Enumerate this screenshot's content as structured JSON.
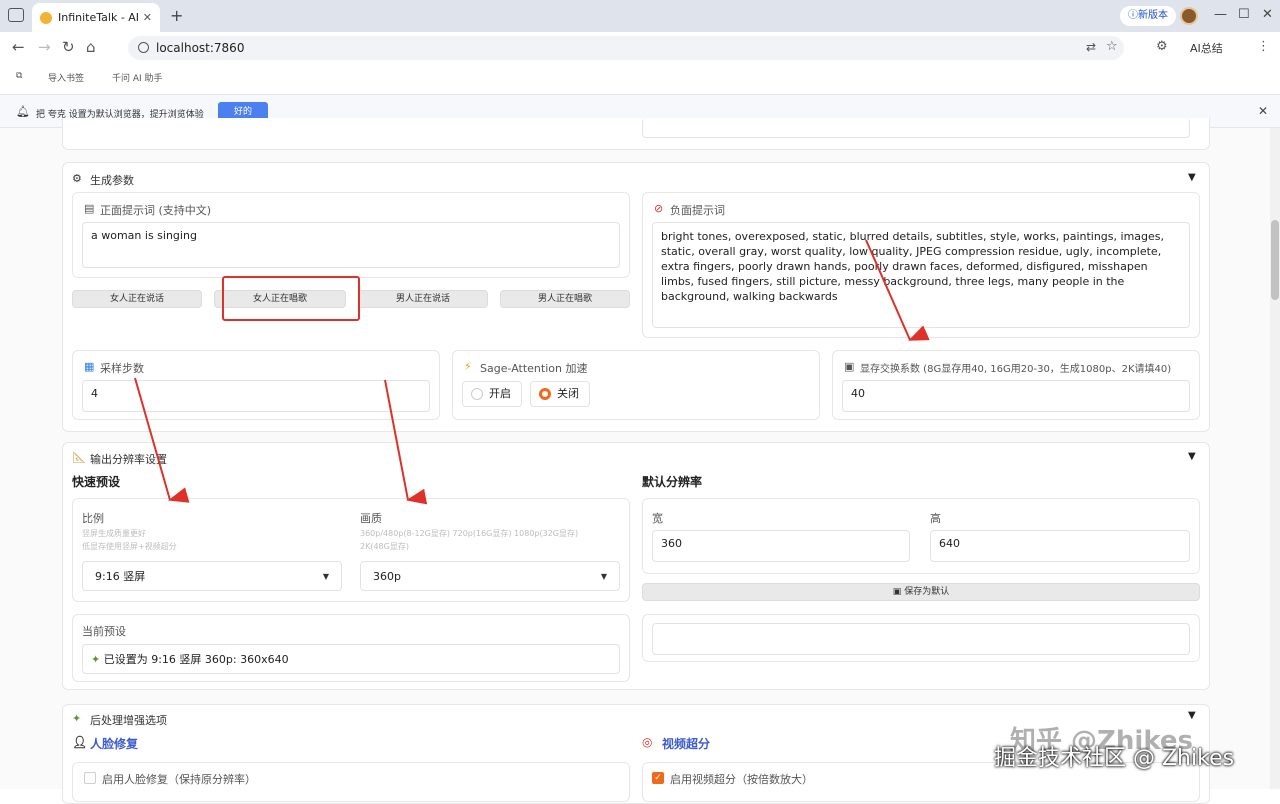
{
  "browser": {
    "tab_title": "InfiniteTalk - AI",
    "tab_close": "✕",
    "new_tab": "+",
    "update_label": "ⓘ新版本",
    "url": "localhost:7860",
    "ai_summary": "AI总结",
    "bookmarks": [
      "导入书签",
      "千问 AI 助手"
    ],
    "infobar_message": "把 夸克 设置为默认浏览器，提升浏览体验",
    "infobar_button": "好的"
  },
  "gen_params": {
    "section_title": "生成参数",
    "positive_label": "正面提示词 (支持中文)",
    "positive_value": "a woman is singing",
    "negative_label": "负面提示词",
    "negative_value": "bright tones, overexposed, static, blurred details, subtitles, style, works, paintings, images, static, overall gray, worst quality, low quality, JPEG compression residue, ugly, incomplete, extra fingers, poorly drawn hands, poorly drawn faces, deformed, disfigured, misshapen limbs, fused fingers, still picture, messy background, three legs, many people in the background, walking backwards",
    "preset_buttons": [
      "女人正在说话",
      "女人正在唱歌",
      "男人正在说话",
      "男人正在唱歌"
    ],
    "steps_label": "采样步数",
    "steps_value": "4",
    "sage_label": "Sage-Attention 加速",
    "sage_on": "开启",
    "sage_off": "关闭",
    "sage_selected": "关闭",
    "vram_label": "显存交换系数 (8G显存用40, 16G用20-30，生成1080p、2K请填40)",
    "vram_value": "40"
  },
  "resolution": {
    "section_title": "输出分辨率设置",
    "quick_title": "快速预设",
    "ratio_label": "比例",
    "ratio_hint_1": "竖屏生成质量更好",
    "ratio_hint_2": "低显存使用竖屏+视频超分",
    "ratio_value": "9:16 竖屏",
    "quality_label": "画质",
    "quality_hint_1": "360p/480p(8-12G显存) 720p(16G显存) 1080p(32G显存)",
    "quality_hint_2": "2K(48G显存)",
    "quality_value": "360p",
    "current_label": "当前预设",
    "current_value": "已设置为 9:16 竖屏 360p: 360x640",
    "default_title": "默认分辨率",
    "width_label": "宽",
    "width_value": "360",
    "height_label": "高",
    "height_value": "640",
    "save_button": "保存为默认"
  },
  "post": {
    "section_title": "后处理增强选项",
    "face_title": "人脸修复",
    "face_checkbox": "启用人脸修复（保持原分辨率）",
    "face_checked": false,
    "sr_title": "视频超分",
    "sr_checkbox": "启用视频超分（按倍数放大）",
    "sr_checked": true
  },
  "watermark": {
    "line1": "知乎 @Zhikes",
    "line2": "掘金技术社区 @ Zhikes"
  },
  "colors": {
    "accent": "#ef6a1b",
    "annotation_red": "#e0302a",
    "link_blue": "#3c5bd1"
  }
}
